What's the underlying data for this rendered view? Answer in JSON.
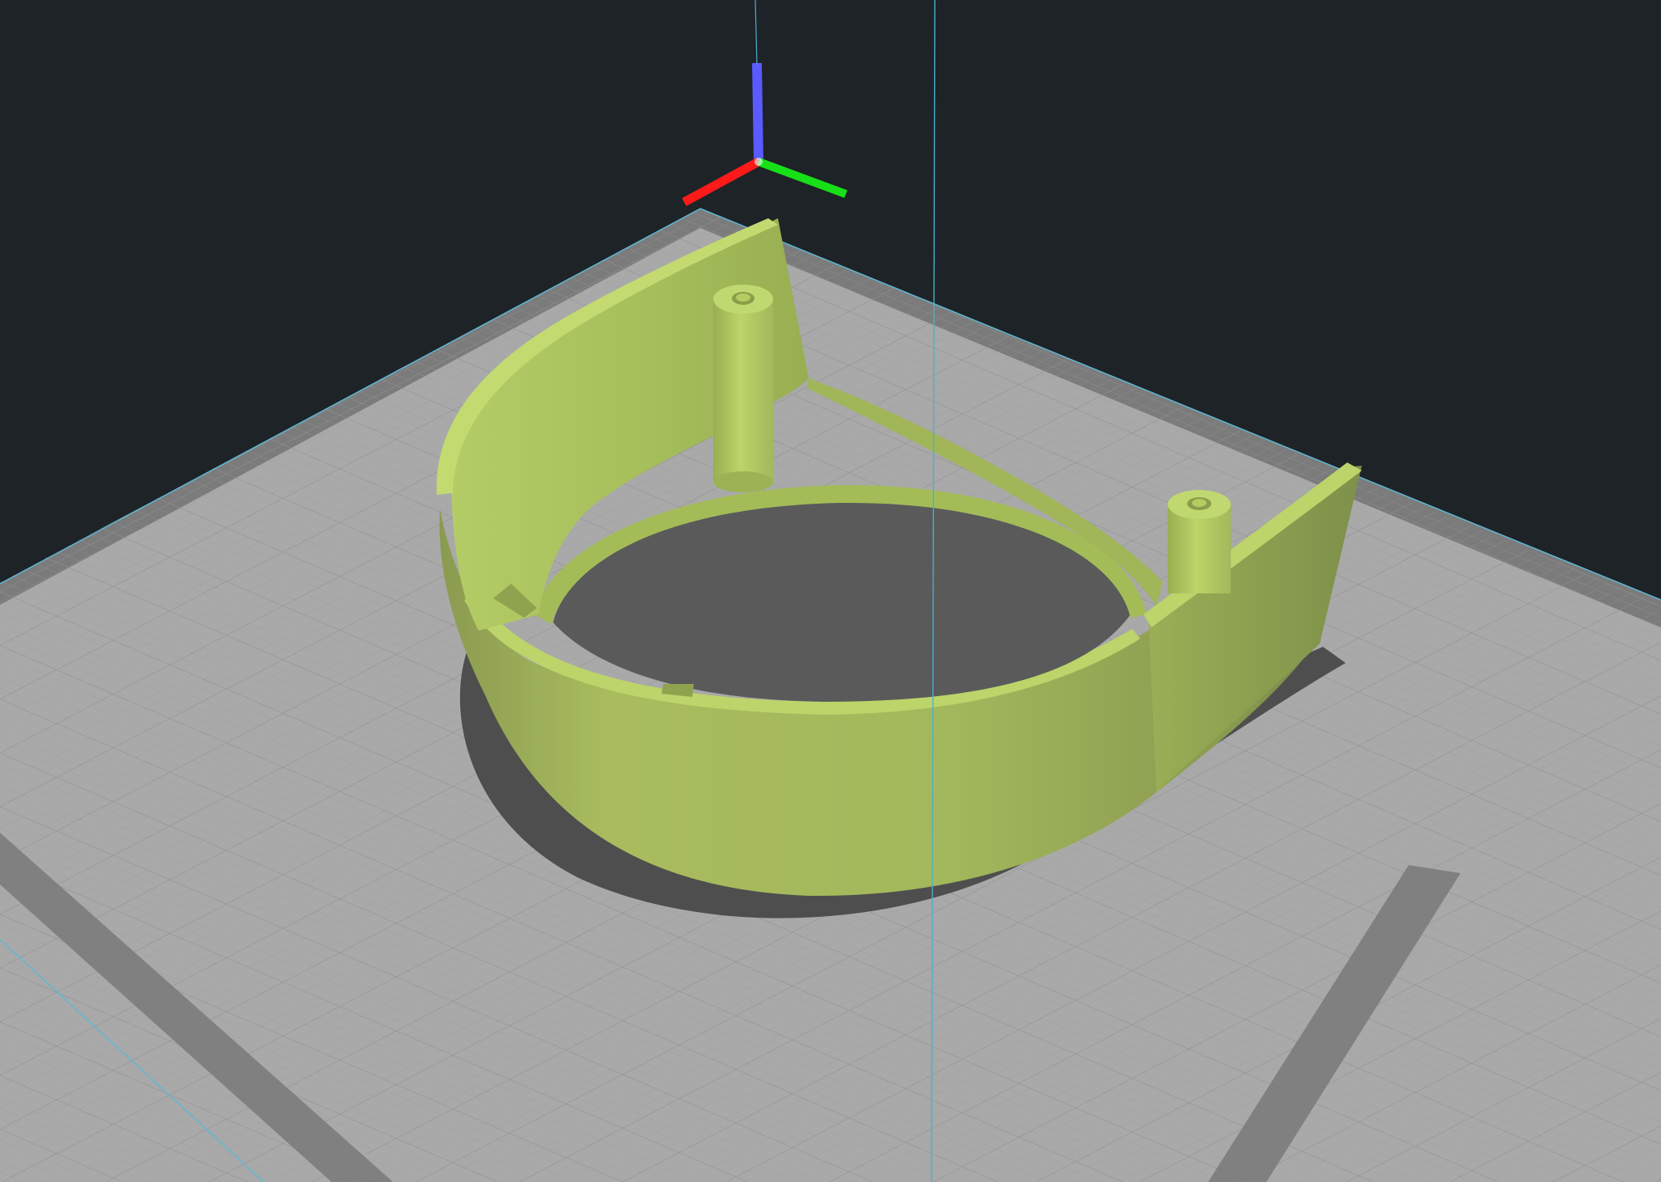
{
  "viewport": {
    "background_color": "#1e2327",
    "view": "3d-perspective"
  },
  "bed": {
    "surface_color": "#a8a8a8",
    "border_color": "#7a7a7a",
    "grid_minor_color": "#9a9a9a",
    "grid_major_color": "#8c8c8c",
    "edge_line_color": "#5fb8d4",
    "grid_visible": true
  },
  "axes": {
    "x_color": "#ff1a1a",
    "y_color": "#18e018",
    "z_color": "#5a5aff"
  },
  "model": {
    "color": "#a8c45a",
    "highlight_color": "#b8d468",
    "shade_color": "#7a8c48",
    "shadow_color": "#4f4f4f",
    "type": "curved-shroud-with-two-standoffs"
  },
  "guide_line": {
    "color": "#4ab0cc"
  }
}
